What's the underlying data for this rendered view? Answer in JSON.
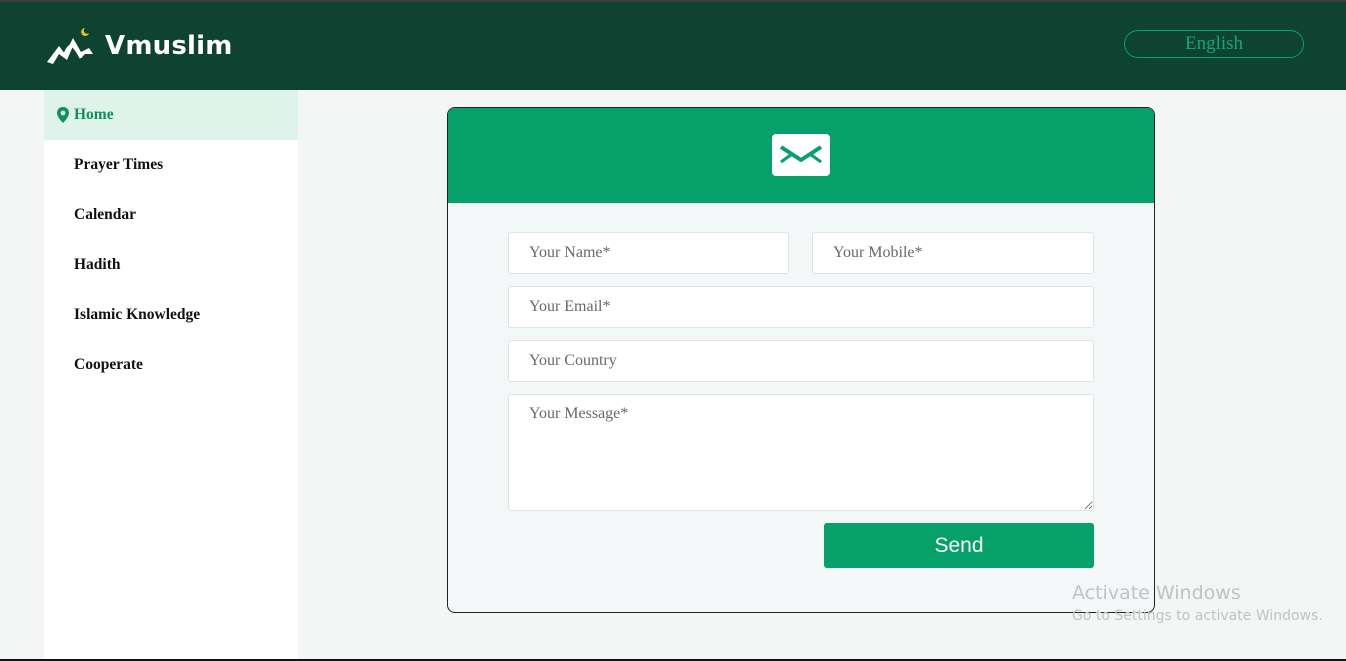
{
  "header": {
    "brand": "Vmuslim",
    "language_button": "English"
  },
  "sidebar": {
    "items": [
      {
        "label": "Home",
        "active": true,
        "icon": "map-pin-icon"
      },
      {
        "label": "Prayer Times"
      },
      {
        "label": "Calendar"
      },
      {
        "label": "Hadith"
      },
      {
        "label": "Islamic Knowledge"
      },
      {
        "label": "Cooperate"
      }
    ]
  },
  "contact_form": {
    "header_icon": "envelope-icon",
    "name_placeholder": "Your Name*",
    "mobile_placeholder": "Your Mobile*",
    "email_placeholder": "Your Email*",
    "country_placeholder": "Your Country",
    "message_placeholder": "Your Message*",
    "send_label": "Send"
  },
  "os_watermark": {
    "title": "Activate Windows",
    "subtitle": "Go to Settings to activate Windows."
  },
  "colors": {
    "header_bg": "#0e4231",
    "accent": "#06a06b",
    "active_nav_bg": "#dff3ea"
  }
}
